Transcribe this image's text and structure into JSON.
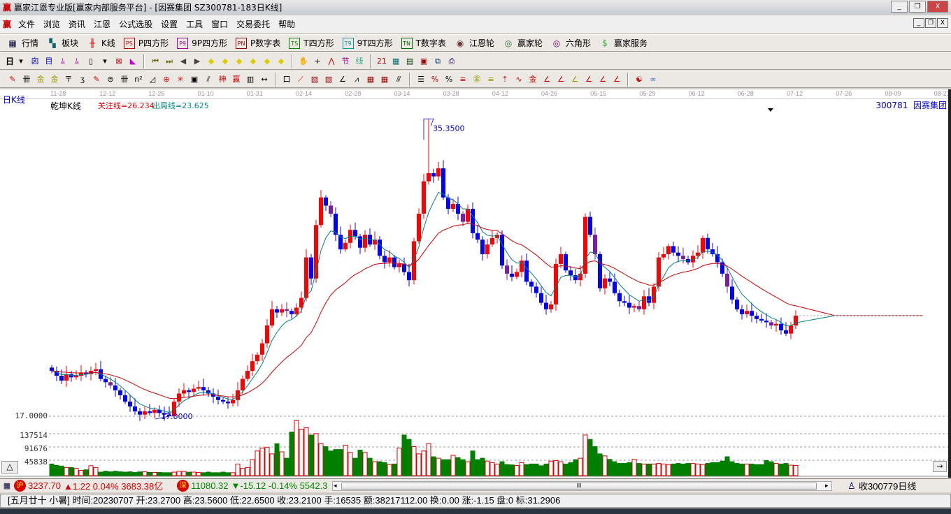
{
  "window": {
    "title": "赢家江恩专业版[赢家内部服务平台] - [因赛集团  SZ300781-183日K线]",
    "logo": "赢",
    "min": "_",
    "restore": "❐",
    "close": "X"
  },
  "menu": [
    "文件",
    "浏览",
    "资讯",
    "江恩",
    "公式选股",
    "设置",
    "工具",
    "窗口",
    "交易委托",
    "帮助"
  ],
  "toolbar1": [
    {
      "icon": "table-icon",
      "g": "▦",
      "c": "#003",
      "label": "行情"
    },
    {
      "icon": "blocks-icon",
      "g": "▚",
      "c": "#066",
      "label": "板块"
    },
    {
      "icon": "kline-icon",
      "g": "╫",
      "c": "#c00",
      "label": "K线"
    },
    {
      "icon": "ps-icon",
      "g": "PS",
      "c": "#c00",
      "label": "P四方形"
    },
    {
      "icon": "p9-icon",
      "g": "P9",
      "c": "#909",
      "label": "9P四方形"
    },
    {
      "icon": "pn-icon",
      "g": "PN",
      "c": "#900",
      "label": "P数字表"
    },
    {
      "icon": "ts-icon",
      "g": "TS",
      "c": "#080",
      "label": "T四方形"
    },
    {
      "icon": "t9-icon",
      "g": "T9",
      "c": "#099",
      "label": "9T四方形"
    },
    {
      "icon": "tn-icon",
      "g": "TN",
      "c": "#060",
      "label": "T数字表"
    },
    {
      "icon": "gann-wheel-icon",
      "g": "◉",
      "c": "#633",
      "label": "江恩轮"
    },
    {
      "icon": "winner-wheel-icon",
      "g": "◎",
      "c": "#363",
      "label": "赢家轮"
    },
    {
      "icon": "hexagon-icon",
      "g": "◎",
      "c": "#606",
      "label": "六角形"
    },
    {
      "icon": "dollar-icon",
      "g": "$",
      "c": "#3a3",
      "label": "赢家服务"
    }
  ],
  "toolbar2": {
    "period": "日",
    "icons": [
      [
        "dropdown-icon",
        "▾",
        "#000"
      ],
      [
        "chart-style-icon",
        "囟",
        "#00c"
      ],
      [
        "doc-icon",
        "目",
        "#00c"
      ],
      [
        "bars3-icon",
        "ﾑ",
        "#909"
      ],
      [
        "bars9-icon",
        "ﾑ",
        "#909"
      ],
      [
        "candle-type-icon",
        "▯",
        "#000"
      ],
      [
        "dropdown-icon",
        "▾",
        "#000"
      ],
      [
        "indicator-icon",
        "⊠",
        "#c00"
      ],
      [
        "flag-icon",
        "◣",
        "#c0c"
      ],
      [
        "first-icon",
        "⏮",
        "#660"
      ],
      [
        "last-icon",
        "⏭",
        "#660"
      ],
      [
        "prev-icon",
        "◀",
        "#444"
      ],
      [
        "next-icon",
        "▶",
        "#444"
      ],
      [
        "diamond-left-icon",
        "◆",
        "#dc0"
      ],
      [
        "diamond-right-icon",
        "◆",
        "#dc0"
      ],
      [
        "diamond-both-icon",
        "◆",
        "#dc0"
      ],
      [
        "diamond-x-icon",
        "◆",
        "#dc0"
      ],
      [
        "diamond-star-icon",
        "◆",
        "#dc0"
      ],
      [
        "diamond-ud-icon",
        "◆",
        "#dc0"
      ],
      [
        "hand-icon",
        "✋",
        "#000"
      ],
      [
        "cross-icon",
        "+",
        "#000"
      ],
      [
        "draw-line-icon",
        "⋀",
        "#c00"
      ],
      [
        "section-icon",
        "节",
        "#909"
      ],
      [
        "wave-icon",
        "线",
        "#3a8"
      ],
      [
        "calendar-icon",
        "21",
        "#c00"
      ],
      [
        "calculator-icon",
        "▦",
        "#066"
      ],
      [
        "notes-icon",
        "▤",
        "#030"
      ],
      [
        "save-icon",
        "▣",
        "#900"
      ],
      [
        "network-icon",
        "⧉",
        "#036"
      ],
      [
        "printer-icon",
        "⎙",
        "#006"
      ]
    ]
  },
  "toolbar3": {
    "icons": [
      [
        "pen-icon",
        "✎",
        "#c00"
      ],
      [
        "grid-lines-icon",
        "卌",
        "#000"
      ],
      [
        "gold-lines-icon",
        "金",
        "#990"
      ],
      [
        "gold-lines2-icon",
        "金",
        "#990"
      ],
      [
        "fan-icon",
        "〒",
        "#000"
      ],
      [
        "spiral-icon",
        "ʒ",
        "#000"
      ],
      [
        "pen2-icon",
        "✎",
        "#c00"
      ],
      [
        "circle-icon",
        "⊜",
        "#000"
      ],
      [
        "parallel-icon",
        "卌",
        "#000"
      ],
      [
        "n2-icon",
        "n²",
        "#000"
      ],
      [
        "triangle-icon",
        "◿",
        "#000"
      ],
      [
        "target-icon",
        "⊕",
        "#c00"
      ],
      [
        "star-icon",
        "✳",
        "#c00"
      ],
      [
        "square-icon",
        "▣",
        "#000"
      ],
      [
        "angle-icon",
        "⫽",
        "#000"
      ],
      [
        "shen-icon",
        "神",
        "#c00"
      ],
      [
        "ying-icon",
        "赢",
        "#c00"
      ],
      [
        "ruler-icon",
        "▥",
        "#000"
      ],
      [
        "range-icon",
        "↔",
        "#000"
      ],
      [
        "box-icon",
        "口",
        "#000"
      ],
      [
        "fan-lines-icon",
        "⟋",
        "#c00"
      ],
      [
        "gann-box-icon",
        "▨",
        "#900"
      ],
      [
        "gann-square-icon",
        "▧",
        "#900"
      ],
      [
        "angle2-icon",
        "∠",
        "#000"
      ],
      [
        "zigzag-icon",
        "⩘",
        "#000"
      ],
      [
        "grid-icon",
        "▦",
        "#900"
      ],
      [
        "grid2-icon",
        "▦",
        "#900"
      ],
      [
        "slash-icon",
        "⫻",
        "#000"
      ],
      [
        "list-icon",
        "☰",
        "#000"
      ],
      [
        "pct-angle-icon",
        "%",
        "#c00"
      ],
      [
        "percent-icon",
        "%",
        "#000"
      ],
      [
        "pct-lines-icon",
        "≡",
        "#c00"
      ],
      [
        "gold-circle-icon",
        "㊎",
        "#990"
      ],
      [
        "gold-lines3-icon",
        "≡",
        "#990"
      ],
      [
        "arrow-up-icon",
        "⇡",
        "#c00"
      ],
      [
        "wave2-icon",
        "∿",
        "#c00"
      ],
      [
        "gold-bar-icon",
        "金",
        "#c00"
      ],
      [
        "fan2-icon",
        "∠",
        "#c00"
      ],
      [
        "fan3-icon",
        "∠",
        "#c00"
      ],
      [
        "fan4-icon",
        "∠",
        "#990"
      ],
      [
        "fan5-icon",
        "∠",
        "#c00"
      ],
      [
        "fan6-icon",
        "∠",
        "#c00"
      ],
      [
        "fan7-icon",
        "∠",
        "#c00"
      ],
      [
        "yinyang-icon",
        "☯",
        "#c00"
      ],
      [
        "infinity-icon",
        "∞",
        "#36c"
      ]
    ]
  },
  "chart": {
    "type_label": "日K线",
    "indicator_name": "乾坤K线",
    "focus_line": "关注线=26.234",
    "exit_line": "出局线=23.625",
    "stock_code": "300781",
    "stock_name": "因赛集团",
    "peak_label": "35.3500",
    "low_label": "17.0000",
    "price_axis_label": "17.0000",
    "volume_ticks": [
      "137514",
      "91676",
      "45838"
    ],
    "dates": [
      "11-28",
      "12-12",
      "12-26",
      "01-10",
      "01-31",
      "02-14",
      "02-28",
      "03-14",
      "03-28",
      "04-12",
      "04-26",
      "05-15",
      "05-29",
      "06-12",
      "06-28",
      "07-12",
      "07-26",
      "08-09",
      "08-23"
    ],
    "up_color": "#ff0000",
    "down_color": "#0000ff",
    "ma_short_color": "#008080",
    "ma_long_color": "#cc0000",
    "vol_down_color": "#008000",
    "collapse": "△",
    "expand": "→"
  },
  "chart_data": {
    "type": "candlestick",
    "peak": 35.35,
    "low": 17.0,
    "closes": [
      19.8,
      19.5,
      19.2,
      19.6,
      19.4,
      19.5,
      19.7,
      19.6,
      19.8,
      19.9,
      19.3,
      19.1,
      18.9,
      18.6,
      18.3,
      17.9,
      17.6,
      17.3,
      17.1,
      17.3,
      17.2,
      17.4,
      17.2,
      17.1,
      17.0,
      17.9,
      18.4,
      18.6,
      18.5,
      18.7,
      18.8,
      18.6,
      18.4,
      18.2,
      18.0,
      17.9,
      17.8,
      18.0,
      18.6,
      19.3,
      19.8,
      20.4,
      20.8,
      21.5,
      22.6,
      23.6,
      23.4,
      23.6,
      23.5,
      23.3,
      23.7,
      24.3,
      26.8,
      25.5,
      28.8,
      30.5,
      30.0,
      29.5,
      28.2,
      27.3,
      27.7,
      28.5,
      28.1,
      27.4,
      28.2,
      27.6,
      27.9,
      26.9,
      26.5,
      26.8,
      26.2,
      26.4,
      25.9,
      25.4,
      27.8,
      29.5,
      31.5,
      32.0,
      31.8,
      32.3,
      30.5,
      29.8,
      30.1,
      29.5,
      29.0,
      29.8,
      28.3,
      27.9,
      27.0,
      27.6,
      28.0,
      28.2,
      26.3,
      25.8,
      25.6,
      25.9,
      26.6,
      25.3,
      25.0,
      24.6,
      24.0,
      23.6,
      23.9,
      26.4,
      27.0,
      26.0,
      25.7,
      25.4,
      25.8,
      29.3,
      28.2,
      27.0,
      24.9,
      25.5,
      25.3,
      24.6,
      24.1,
      24.0,
      23.7,
      23.8,
      23.6,
      24.4,
      24.0,
      25.0,
      26.8,
      27.0,
      27.5,
      27.1,
      26.9,
      26.7,
      26.5,
      26.9,
      27.1,
      28.0,
      27.3,
      27.0,
      26.5,
      25.8,
      25.0,
      24.2,
      23.6,
      23.3,
      23.5,
      23.2,
      23.0,
      22.9,
      22.8,
      22.6,
      22.7,
      22.3,
      22.1,
      22.6,
      23.21
    ],
    "volumes_k": [
      40,
      35,
      33,
      28,
      28,
      25,
      18,
      20,
      34,
      28,
      12,
      15,
      13,
      15,
      13,
      12,
      13,
      11,
      13,
      13,
      11,
      11,
      11,
      10,
      10,
      12,
      15,
      14,
      12,
      12,
      11,
      10,
      12,
      10,
      10,
      12,
      10,
      10,
      40,
      25,
      28,
      55,
      85,
      95,
      98,
      75,
      110,
      82,
      60,
      150,
      190,
      160,
      165,
      140,
      145,
      110,
      100,
      85,
      90,
      90,
      105,
      80,
      60,
      88,
      80,
      60,
      48,
      48,
      45,
      38,
      40,
      95,
      140,
      125,
      100,
      75,
      85,
      110,
      65,
      60,
      55,
      55,
      70,
      62,
      55,
      48,
      85,
      55,
      60,
      50,
      45,
      40,
      48,
      38,
      37,
      35,
      45,
      38,
      40,
      40,
      34,
      40,
      50,
      52,
      48,
      40,
      45,
      55,
      60,
      140,
      125,
      100,
      75,
      68,
      56,
      48,
      42,
      42,
      45,
      56,
      42,
      40,
      40,
      40,
      42,
      40,
      38,
      40,
      42,
      40,
      42,
      42,
      40,
      38,
      42,
      45,
      45,
      50,
      65,
      48,
      42,
      40,
      40,
      40,
      38,
      38,
      52,
      48,
      42,
      40,
      42,
      36,
      35
    ]
  },
  "status": {
    "sh_icon": "沪",
    "sh_index": "3237.70",
    "sh_change": "▲1.22 0.04% 3683.38亿",
    "sz_icon": "深",
    "sz_index": "11080.32",
    "sz_change": "▼-15.12 -0.14% 5542.3",
    "scroll_left": "◂",
    "scroll_thumb": "III",
    "scroll_right": "▸",
    "receive": "收300779日线"
  },
  "info": "[五月廿十 小暑] 时间:20230707 开:23.2700 高:23.5600 低:22.6500 收:23.2100 手:16535 额:38217112.00 换:0.00 涨:-1.15 盘:0 标:31.2906"
}
